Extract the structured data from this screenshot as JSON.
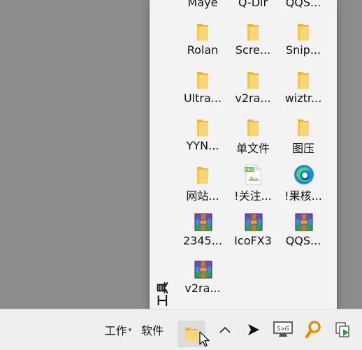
{
  "popup": {
    "side_title": "工具",
    "items": [
      {
        "label": "Maye",
        "icon": "folder-icon"
      },
      {
        "label": "Q-Dir",
        "icon": "folder-icon"
      },
      {
        "label": "QQS...",
        "icon": "folder-icon"
      },
      {
        "label": "Rolan",
        "icon": "folder-icon"
      },
      {
        "label": "Scre...",
        "icon": "folder-icon"
      },
      {
        "label": "Snip...",
        "icon": "folder-icon"
      },
      {
        "label": "Ultra...",
        "icon": "folder-icon"
      },
      {
        "label": "v2ra...",
        "icon": "folder-icon"
      },
      {
        "label": "wiztr...",
        "icon": "folder-icon"
      },
      {
        "label": "YYN...",
        "icon": "folder-icon"
      },
      {
        "label": "单文件",
        "icon": "folder-icon"
      },
      {
        "label": "图压",
        "icon": "folder-icon"
      },
      {
        "label": "网站...",
        "icon": "folder-icon"
      },
      {
        "label": "!关注...",
        "icon": "png-file-icon"
      },
      {
        "label": "!果核...",
        "icon": "edge-icon"
      },
      {
        "label": "2345...",
        "icon": "winrar-archive-icon"
      },
      {
        "label": "IcoFX3",
        "icon": "winrar-archive-icon"
      },
      {
        "label": "QQS...",
        "icon": "winrar-archive-icon"
      },
      {
        "label": "v2ra...",
        "icon": "winrar-archive-icon"
      }
    ]
  },
  "taskbar": {
    "toolbar_work": "工作",
    "toolbar_software": "软件",
    "tray_overflow_icon": "chevron-up-icon",
    "tray_icons": [
      "arrow-cursor-icon",
      "screen-sg-icon",
      "magnifier-icon",
      "copy-arrow-icon"
    ]
  },
  "colors": {
    "desktop": "#8c8c8c",
    "popup_bg": "#f3f3f3",
    "taskbar_bg": "#efefef",
    "folder_yellow": "#f7d673",
    "folder_dark": "#e8b83e"
  }
}
